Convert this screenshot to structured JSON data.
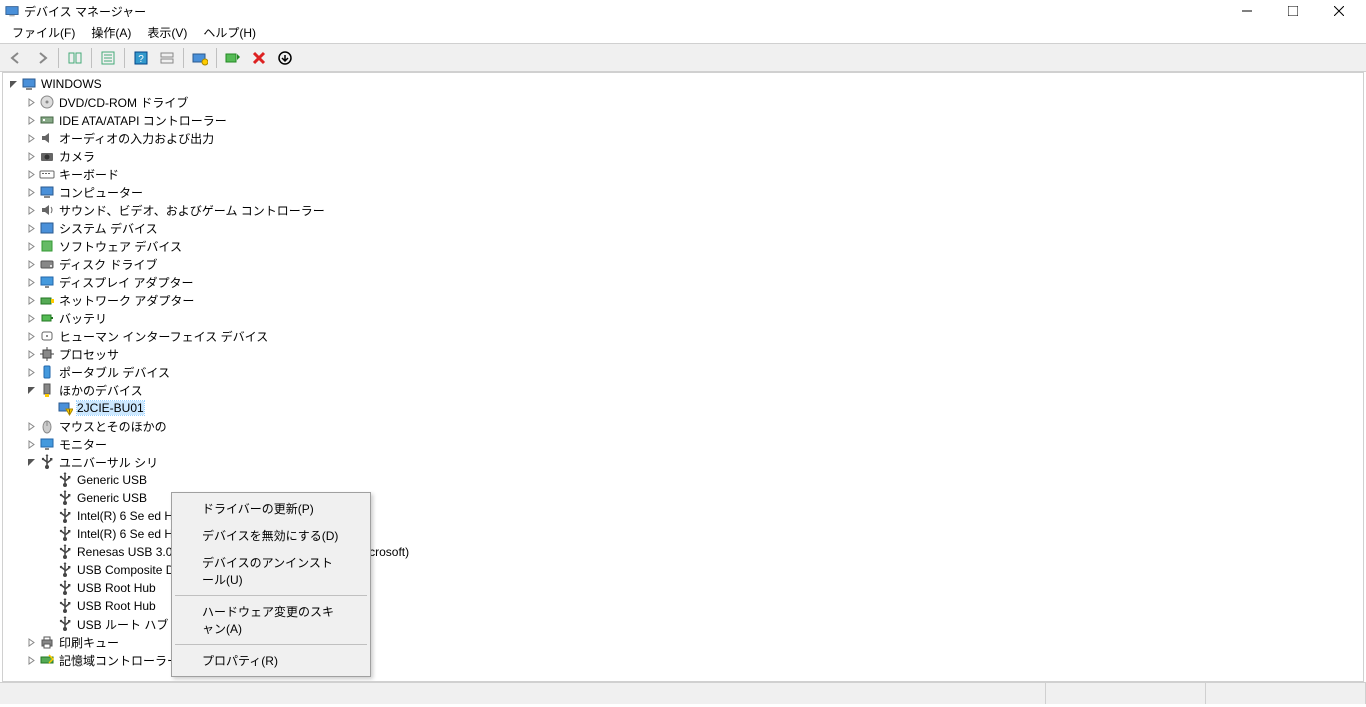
{
  "window": {
    "title": "デバイス マネージャー"
  },
  "menu": {
    "file": "ファイル(F)",
    "action": "操作(A)",
    "view": "表示(V)",
    "help": "ヘルプ(H)"
  },
  "root": "WINDOWS",
  "categories": [
    {
      "label": "DVD/CD-ROM ドライブ",
      "icon": "disc"
    },
    {
      "label": "IDE ATA/ATAPI コントローラー",
      "icon": "ide"
    },
    {
      "label": "オーディオの入力および出力",
      "icon": "audio"
    },
    {
      "label": "カメラ",
      "icon": "camera"
    },
    {
      "label": "キーボード",
      "icon": "keyboard"
    },
    {
      "label": "コンピューター",
      "icon": "computer"
    },
    {
      "label": "サウンド、ビデオ、およびゲーム コントローラー",
      "icon": "sound"
    },
    {
      "label": "システム デバイス",
      "icon": "system"
    },
    {
      "label": "ソフトウェア デバイス",
      "icon": "software"
    },
    {
      "label": "ディスク ドライブ",
      "icon": "disk"
    },
    {
      "label": "ディスプレイ アダプター",
      "icon": "display"
    },
    {
      "label": "ネットワーク アダプター",
      "icon": "network"
    },
    {
      "label": "バッテリ",
      "icon": "battery"
    },
    {
      "label": "ヒューマン インターフェイス デバイス",
      "icon": "hid"
    },
    {
      "label": "プロセッサ",
      "icon": "cpu"
    },
    {
      "label": "ポータブル デバイス",
      "icon": "portable"
    }
  ],
  "other_devices": {
    "label": "ほかのデバイス",
    "child": "2JCIE-BU01"
  },
  "after_other": [
    {
      "label": "マウスとそのほかの",
      "icon": "mouse"
    },
    {
      "label": "モニター",
      "icon": "monitor"
    }
  ],
  "usb": {
    "label": "ユニバーサル シリ",
    "children": [
      "Generic USB",
      "Generic USB",
      "Intel(R) 6 Se                                                                       ed Host Controller - 1C2D",
      "Intel(R) 6 Se                                                                       ed Host Controller - 1C26",
      "Renesas USB 3.0 eXtensible Host Controller - 0.96 (Microsoft)",
      "USB Composite Device",
      "USB Root Hub",
      "USB Root Hub",
      "USB ルート ハブ (USB 3.0)"
    ]
  },
  "trailing": [
    {
      "label": "印刷キュー",
      "icon": "printer"
    },
    {
      "label": "記憶域コントローラー",
      "icon": "storage"
    }
  ],
  "context_menu": {
    "update_driver": "ドライバーの更新(P)",
    "disable": "デバイスを無効にする(D)",
    "uninstall": "デバイスのアンインストール(U)",
    "scan": "ハードウェア変更のスキャン(A)",
    "properties": "プロパティ(R)"
  }
}
